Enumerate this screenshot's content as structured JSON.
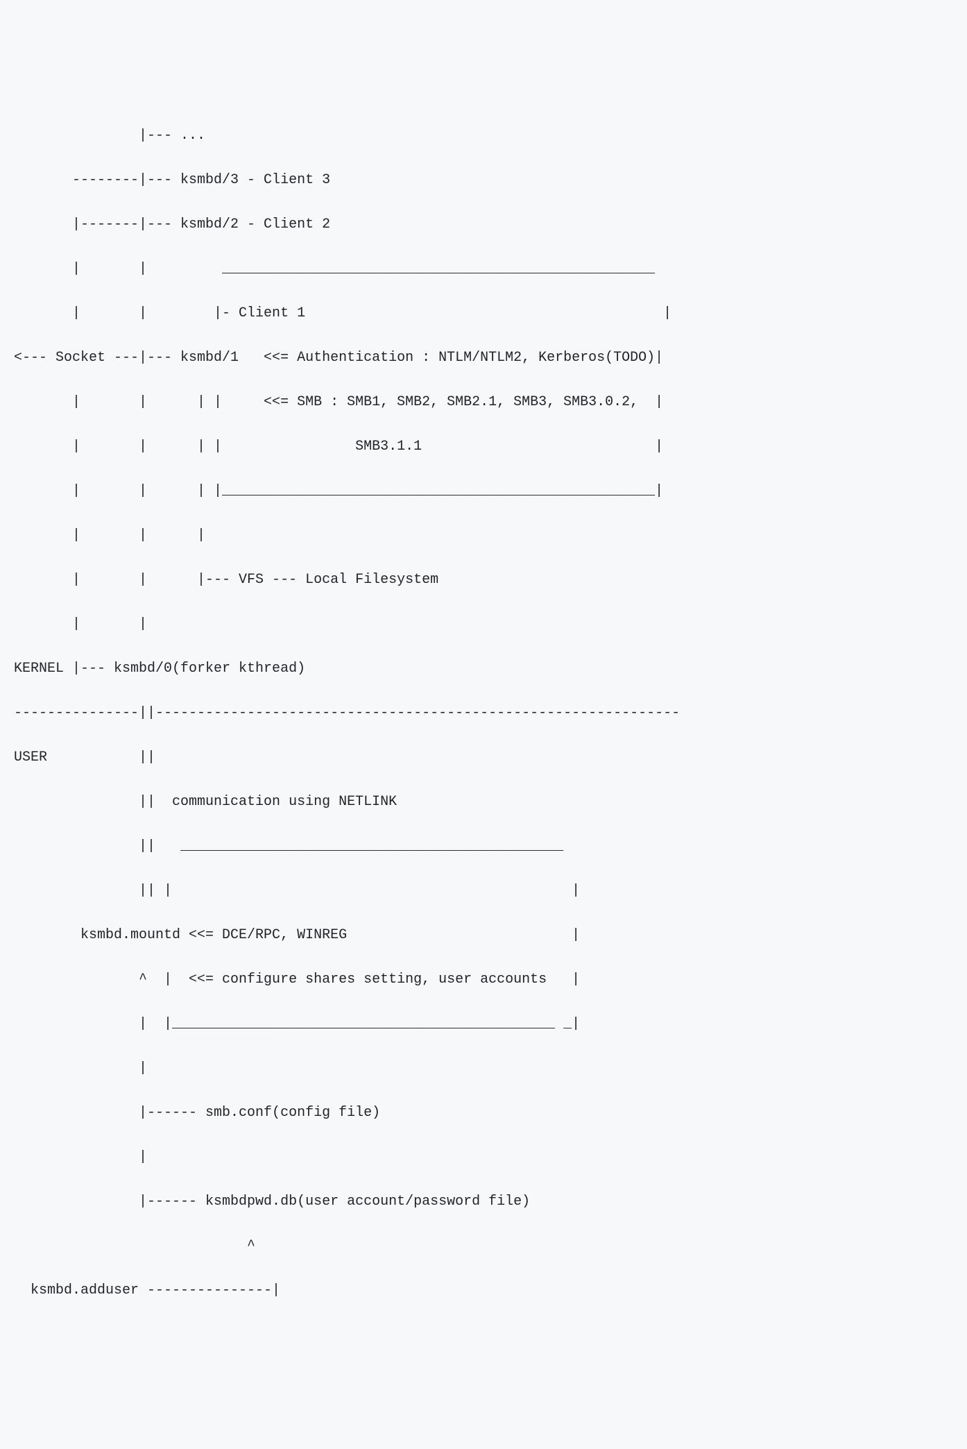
{
  "diagram": {
    "lines": [
      "               |--- ...",
      "       --------|--- ksmbd/3 - Client 3",
      "       |-------|--- ksmbd/2 - Client 2",
      "       |       |         ____________________________________________________",
      "       |       |        |- Client 1                                           |",
      "<--- Socket ---|--- ksmbd/1   <<= Authentication : NTLM/NTLM2, Kerberos(TODO)|",
      "       |       |      | |     <<= SMB : SMB1, SMB2, SMB2.1, SMB3, SMB3.0.2,  |",
      "       |       |      | |                SMB3.1.1                            |",
      "       |       |      | |____________________________________________________|",
      "       |       |      |",
      "       |       |      |--- VFS --- Local Filesystem",
      "       |       |",
      "KERNEL |--- ksmbd/0(forker kthread)",
      "---------------||---------------------------------------------------------------",
      "USER           ||",
      "               ||  communication using NETLINK",
      "               ||   ______________________________________________",
      "               || |                                                |",
      "        ksmbd.mountd <<= DCE/RPC, WINREG                           |",
      "               ^  |  <<= configure shares setting, user accounts   |",
      "               |  |______________________________________________ _|",
      "               |",
      "               |------ smb.conf(config file)",
      "               |",
      "               |------ ksmbdpwd.db(user account/password file)",
      "                            ^",
      "  ksmbd.adduser ---------------|"
    ]
  },
  "entities": {
    "kernel_label": "KERNEL",
    "user_label": "USER",
    "socket": "Socket",
    "threads": {
      "forker": "ksmbd/0(forker kthread)",
      "client1": "ksmbd/1",
      "client2": "ksmbd/2 - Client 2",
      "client3": "ksmbd/3 - Client 3",
      "more": "..."
    },
    "client1_box": {
      "title": "Client 1",
      "auth": "Authentication : NTLM/NTLM2, Kerberos(TODO)",
      "smb": "SMB : SMB1, SMB2, SMB2.1, SMB3, SMB3.0.2,",
      "smb_cont": "SMB3.1.1"
    },
    "vfs": "VFS --- Local Filesystem",
    "netlink": "communication using NETLINK",
    "mountd": {
      "name": "ksmbd.mountd",
      "proto": "DCE/RPC, WINREG",
      "config": "configure shares setting, user accounts"
    },
    "files": {
      "smb_conf": "smb.conf(config file)",
      "pwd_db": "ksmbdpwd.db(user account/password file)"
    },
    "adduser": "ksmbd.adduser"
  }
}
